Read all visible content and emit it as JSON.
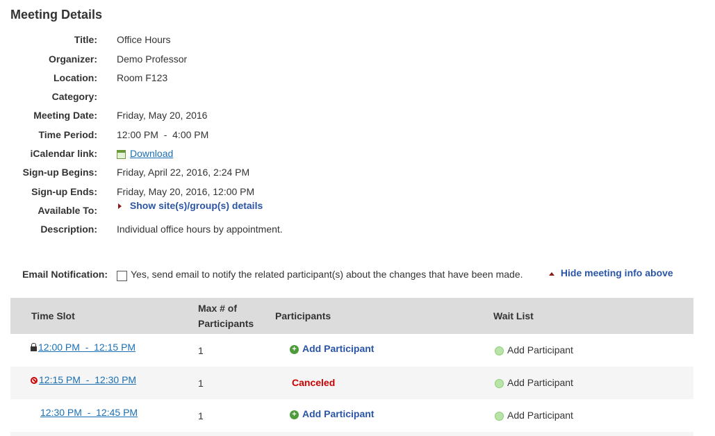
{
  "page_title": "Meeting Details",
  "details": [
    {
      "label": "Title:",
      "value": "Office Hours"
    },
    {
      "label": "Organizer:",
      "value": "Demo Professor"
    },
    {
      "label": "Location:",
      "value": "Room F123"
    },
    {
      "label": "Category:",
      "value": ""
    },
    {
      "label": "Meeting Date:",
      "value": "Friday, May 20, 2016"
    },
    {
      "label": "Time Period:",
      "value": "12:00 PM  -  4:00 PM"
    },
    {
      "label": "iCalendar link:",
      "value": "Download"
    },
    {
      "label": "Sign-up Begins:",
      "value": "Friday, April 22, 2016, 2:24 PM"
    },
    {
      "label": "Sign-up Ends:",
      "value": "Friday, May 20, 2016, 12:00 PM"
    },
    {
      "label": "Available To:",
      "value": "Show site(s)/group(s) details"
    },
    {
      "label": "Description:",
      "value": "Individual office hours by appointment."
    }
  ],
  "email_notification": {
    "label": "Email Notification:",
    "checkbox_text": "Yes, send email to notify the related participant(s) about the changes that have been made.",
    "checked": false
  },
  "hide_info_link": "Hide meeting info above",
  "table": {
    "headers": {
      "time_slot": "Time Slot",
      "max_line1": "Max # of",
      "max_line2": "Participants",
      "participants": "Participants",
      "wait_list": "Wait List"
    },
    "rows": [
      {
        "time": "12:00 PM  -  12:15 PM",
        "status_icon": "lock-icon",
        "max": "1",
        "participants": "Add Participant",
        "canceled": false,
        "wait": "Add Participant"
      },
      {
        "time": "12:15 PM  -  12:30 PM",
        "status_icon": "cancel-icon",
        "max": "1",
        "participants": "Canceled",
        "canceled": true,
        "wait": "Add Participant"
      },
      {
        "time": "12:30 PM  -  12:45 PM",
        "status_icon": "",
        "max": "1",
        "participants": "Add Participant",
        "canceled": false,
        "wait": "Add Participant"
      }
    ]
  },
  "colors": {
    "link": "#1a6fb5",
    "action": "#2a55a6",
    "canceled": "#cc0000",
    "header_bg": "#dcdcdc"
  }
}
